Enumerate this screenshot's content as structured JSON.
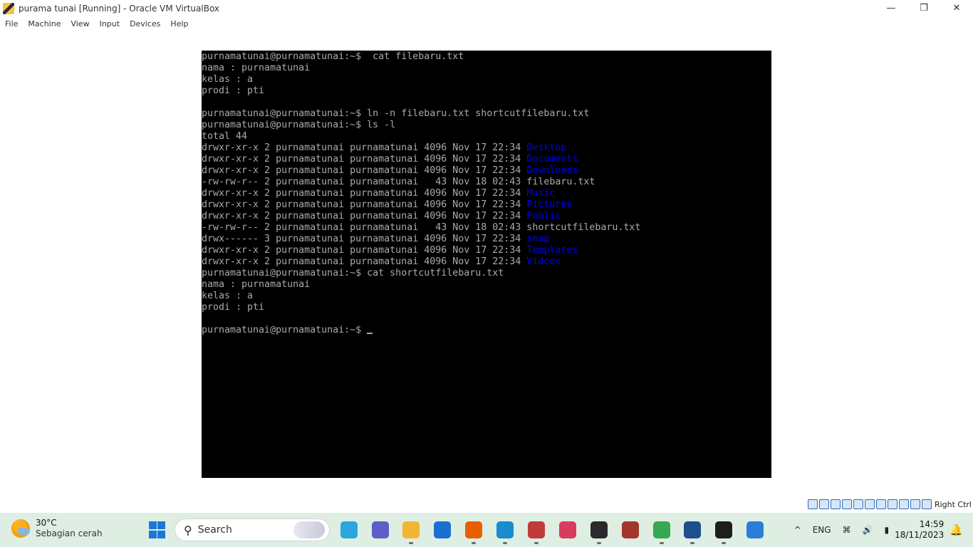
{
  "window": {
    "title": "purama tunai [Running] - Oracle VM VirtualBox",
    "minimize_glyph": "—",
    "restore_glyph": "❐",
    "close_glyph": "✕"
  },
  "menu": [
    "File",
    "Machine",
    "View",
    "Input",
    "Devices",
    "Help"
  ],
  "terminal": {
    "lines": [
      [
        {
          "t": "purnamatunai@purnamatunai:~$  cat filebaru.txt",
          "c": ""
        }
      ],
      [
        {
          "t": "nama : purnamatunai",
          "c": ""
        }
      ],
      [
        {
          "t": "kelas : a",
          "c": ""
        }
      ],
      [
        {
          "t": "prodi : pti",
          "c": ""
        }
      ],
      [
        {
          "t": "",
          "c": ""
        }
      ],
      [
        {
          "t": "purnamatunai@purnamatunai:~$ ln -n filebaru.txt shortcutfilebaru.txt",
          "c": ""
        }
      ],
      [
        {
          "t": "purnamatunai@purnamatunai:~$ ls -l",
          "c": ""
        }
      ],
      [
        {
          "t": "total 44",
          "c": ""
        }
      ],
      [
        {
          "t": "drwxr-xr-x 2 purnamatunai purnamatunai 4096 Nov 17 22:34 ",
          "c": ""
        },
        {
          "t": "Desktop",
          "c": "dir"
        }
      ],
      [
        {
          "t": "drwxr-xr-x 2 purnamatunai purnamatunai 4096 Nov 17 22:34 ",
          "c": ""
        },
        {
          "t": "Documents",
          "c": "dir"
        }
      ],
      [
        {
          "t": "drwxr-xr-x 2 purnamatunai purnamatunai 4096 Nov 17 22:34 ",
          "c": ""
        },
        {
          "t": "Downloads",
          "c": "dir"
        }
      ],
      [
        {
          "t": "-rw-rw-r-- 2 purnamatunai purnamatunai   43 Nov 18 02:43 filebaru.txt",
          "c": ""
        }
      ],
      [
        {
          "t": "drwxr-xr-x 2 purnamatunai purnamatunai 4096 Nov 17 22:34 ",
          "c": ""
        },
        {
          "t": "Music",
          "c": "dir"
        }
      ],
      [
        {
          "t": "drwxr-xr-x 2 purnamatunai purnamatunai 4096 Nov 17 22:34 ",
          "c": ""
        },
        {
          "t": "Pictures",
          "c": "dir"
        }
      ],
      [
        {
          "t": "drwxr-xr-x 2 purnamatunai purnamatunai 4096 Nov 17 22:34 ",
          "c": ""
        },
        {
          "t": "Public",
          "c": "dir"
        }
      ],
      [
        {
          "t": "-rw-rw-r-- 2 purnamatunai purnamatunai   43 Nov 18 02:43 shortcutfilebaru.txt",
          "c": ""
        }
      ],
      [
        {
          "t": "drwx------ 3 purnamatunai purnamatunai 4096 Nov 17 22:34 ",
          "c": ""
        },
        {
          "t": "snap",
          "c": "dir"
        }
      ],
      [
        {
          "t": "drwxr-xr-x 2 purnamatunai purnamatunai 4096 Nov 17 22:34 ",
          "c": ""
        },
        {
          "t": "Templates",
          "c": "dir"
        }
      ],
      [
        {
          "t": "drwxr-xr-x 2 purnamatunai purnamatunai 4096 Nov 17 22:34 ",
          "c": ""
        },
        {
          "t": "Videos",
          "c": "dir"
        }
      ],
      [
        {
          "t": "purnamatunai@purnamatunai:~$ cat shortcutfilebaru.txt",
          "c": ""
        }
      ],
      [
        {
          "t": "nama : purnamatunai",
          "c": ""
        }
      ],
      [
        {
          "t": "kelas : a",
          "c": ""
        }
      ],
      [
        {
          "t": "prodi : pti",
          "c": ""
        }
      ],
      [
        {
          "t": "",
          "c": ""
        }
      ],
      [
        {
          "t": "purnamatunai@purnamatunai:~$ ",
          "c": ""
        },
        {
          "t": "",
          "c": "cursor"
        }
      ]
    ]
  },
  "statusbar": {
    "icons": [
      "hard-disk-icon",
      "optical-drive-icon",
      "audio-icon",
      "network-icon",
      "usb-icon",
      "shared-folder-icon",
      "display-icon",
      "recording-icon",
      "cpu-icon",
      "mouse-integration-icon",
      "keyboard-icon"
    ],
    "host_key": "Right Ctrl"
  },
  "taskbar": {
    "weather_temp": "30°C",
    "weather_condition": "Sebagian cerah",
    "search_placeholder": "Search",
    "apps": [
      {
        "name": "widgets-copilot-icon",
        "color": "#2aa6df"
      },
      {
        "name": "teams-icon",
        "color": "#5b5fc7"
      },
      {
        "name": "file-explorer-icon",
        "color": "#f2b632"
      },
      {
        "name": "defender-icon",
        "color": "#1b6fd1"
      },
      {
        "name": "firefox-icon",
        "color": "#e66000"
      },
      {
        "name": "edge-icon",
        "color": "#1a8bd1"
      },
      {
        "name": "snipping-tool-icon",
        "color": "#c23b3b"
      },
      {
        "name": "wps-icon",
        "color": "#d83b5e"
      },
      {
        "name": "terminal-icon",
        "color": "#2b2b2b"
      },
      {
        "name": "winrar-icon",
        "color": "#a0362c"
      },
      {
        "name": "chrome-icon",
        "color": "#34a853"
      },
      {
        "name": "virtualbox-icon",
        "color": "#1f4e8c"
      },
      {
        "name": "vm-window-icon",
        "color": "#1e1e1e"
      },
      {
        "name": "paint-icon",
        "color": "#2b7ed8"
      }
    ],
    "tray_chevron": "^",
    "language": "ENG",
    "time": "14:59",
    "date": "18/11/2023"
  }
}
